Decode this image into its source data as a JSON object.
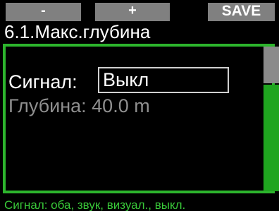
{
  "softkeys": {
    "left": "-",
    "middle": "+",
    "right": "SAVE"
  },
  "menu": {
    "title": "6.1.Макс.глубина"
  },
  "settings": {
    "signal_label": "Сигнал:",
    "signal_value": "Выкл",
    "depth_label": "Глубина:",
    "depth_value": "40.0 m"
  },
  "hint": "Сигнал: оба, звук, визуал., выкл.",
  "colors": {
    "accent": "#2db52d",
    "softkey": "#808080",
    "background": "#000000",
    "inactive_text": "#8f8f8f"
  }
}
